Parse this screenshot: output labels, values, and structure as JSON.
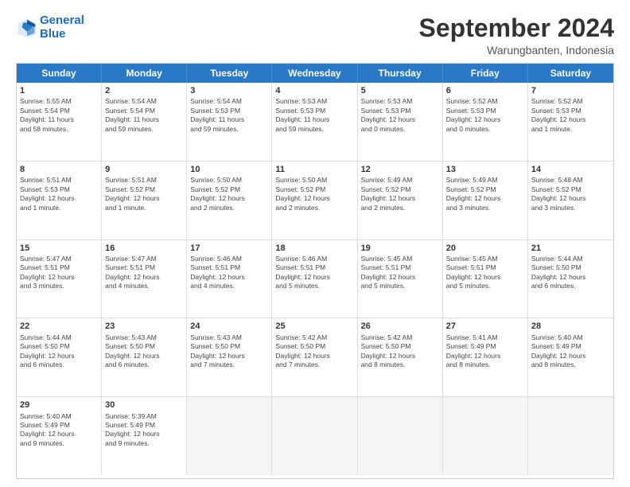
{
  "header": {
    "logo_line1": "General",
    "logo_line2": "Blue",
    "month_title": "September 2024",
    "location": "Warungbanten, Indonesia"
  },
  "weekdays": [
    "Sunday",
    "Monday",
    "Tuesday",
    "Wednesday",
    "Thursday",
    "Friday",
    "Saturday"
  ],
  "rows": [
    [
      {
        "day": "",
        "text": ""
      },
      {
        "day": "2",
        "text": "Sunrise: 5:54 AM\nSunset: 5:54 PM\nDaylight: 11 hours\nand 59 minutes."
      },
      {
        "day": "3",
        "text": "Sunrise: 5:54 AM\nSunset: 5:53 PM\nDaylight: 11 hours\nand 59 minutes."
      },
      {
        "day": "4",
        "text": "Sunrise: 5:53 AM\nSunset: 5:53 PM\nDaylight: 11 hours\nand 59 minutes."
      },
      {
        "day": "5",
        "text": "Sunrise: 5:53 AM\nSunset: 5:53 PM\nDaylight: 12 hours\nand 0 minutes."
      },
      {
        "day": "6",
        "text": "Sunrise: 5:52 AM\nSunset: 5:53 PM\nDaylight: 12 hours\nand 0 minutes."
      },
      {
        "day": "7",
        "text": "Sunrise: 5:52 AM\nSunset: 5:53 PM\nDaylight: 12 hours\nand 1 minute."
      }
    ],
    [
      {
        "day": "1",
        "text": "Sunrise: 5:55 AM\nSunset: 5:54 PM\nDaylight: 11 hours\nand 58 minutes."
      },
      {
        "day": "8",
        "text": "Sunrise: 5:51 AM\nSunset: 5:53 PM\nDaylight: 12 hours\nand 1 minute."
      },
      {
        "day": "9",
        "text": "Sunrise: 5:51 AM\nSunset: 5:52 PM\nDaylight: 12 hours\nand 1 minute."
      },
      {
        "day": "10",
        "text": "Sunrise: 5:50 AM\nSunset: 5:52 PM\nDaylight: 12 hours\nand 2 minutes."
      },
      {
        "day": "11",
        "text": "Sunrise: 5:50 AM\nSunset: 5:52 PM\nDaylight: 12 hours\nand 2 minutes."
      },
      {
        "day": "12",
        "text": "Sunrise: 5:49 AM\nSunset: 5:52 PM\nDaylight: 12 hours\nand 2 minutes."
      },
      {
        "day": "13",
        "text": "Sunrise: 5:49 AM\nSunset: 5:52 PM\nDaylight: 12 hours\nand 3 minutes."
      },
      {
        "day": "14",
        "text": "Sunrise: 5:48 AM\nSunset: 5:52 PM\nDaylight: 12 hours\nand 3 minutes."
      }
    ],
    [
      {
        "day": "15",
        "text": "Sunrise: 5:47 AM\nSunset: 5:51 PM\nDaylight: 12 hours\nand 3 minutes."
      },
      {
        "day": "16",
        "text": "Sunrise: 5:47 AM\nSunset: 5:51 PM\nDaylight: 12 hours\nand 4 minutes."
      },
      {
        "day": "17",
        "text": "Sunrise: 5:46 AM\nSunset: 5:51 PM\nDaylight: 12 hours\nand 4 minutes."
      },
      {
        "day": "18",
        "text": "Sunrise: 5:46 AM\nSunset: 5:51 PM\nDaylight: 12 hours\nand 5 minutes."
      },
      {
        "day": "19",
        "text": "Sunrise: 5:45 AM\nSunset: 5:51 PM\nDaylight: 12 hours\nand 5 minutes."
      },
      {
        "day": "20",
        "text": "Sunrise: 5:45 AM\nSunset: 5:51 PM\nDaylight: 12 hours\nand 5 minutes."
      },
      {
        "day": "21",
        "text": "Sunrise: 5:44 AM\nSunset: 5:50 PM\nDaylight: 12 hours\nand 6 minutes."
      }
    ],
    [
      {
        "day": "22",
        "text": "Sunrise: 5:44 AM\nSunset: 5:50 PM\nDaylight: 12 hours\nand 6 minutes."
      },
      {
        "day": "23",
        "text": "Sunrise: 5:43 AM\nSunset: 5:50 PM\nDaylight: 12 hours\nand 6 minutes."
      },
      {
        "day": "24",
        "text": "Sunrise: 5:43 AM\nSunset: 5:50 PM\nDaylight: 12 hours\nand 7 minutes."
      },
      {
        "day": "25",
        "text": "Sunrise: 5:42 AM\nSunset: 5:50 PM\nDaylight: 12 hours\nand 7 minutes."
      },
      {
        "day": "26",
        "text": "Sunrise: 5:42 AM\nSunset: 5:50 PM\nDaylight: 12 hours\nand 8 minutes."
      },
      {
        "day": "27",
        "text": "Sunrise: 5:41 AM\nSunset: 5:49 PM\nDaylight: 12 hours\nand 8 minutes."
      },
      {
        "day": "28",
        "text": "Sunrise: 5:40 AM\nSunset: 5:49 PM\nDaylight: 12 hours\nand 8 minutes."
      }
    ],
    [
      {
        "day": "29",
        "text": "Sunrise: 5:40 AM\nSunset: 5:49 PM\nDaylight: 12 hours\nand 9 minutes."
      },
      {
        "day": "30",
        "text": "Sunrise: 5:39 AM\nSunset: 5:49 PM\nDaylight: 12 hours\nand 9 minutes."
      },
      {
        "day": "",
        "text": ""
      },
      {
        "day": "",
        "text": ""
      },
      {
        "day": "",
        "text": ""
      },
      {
        "day": "",
        "text": ""
      },
      {
        "day": "",
        "text": ""
      }
    ]
  ]
}
